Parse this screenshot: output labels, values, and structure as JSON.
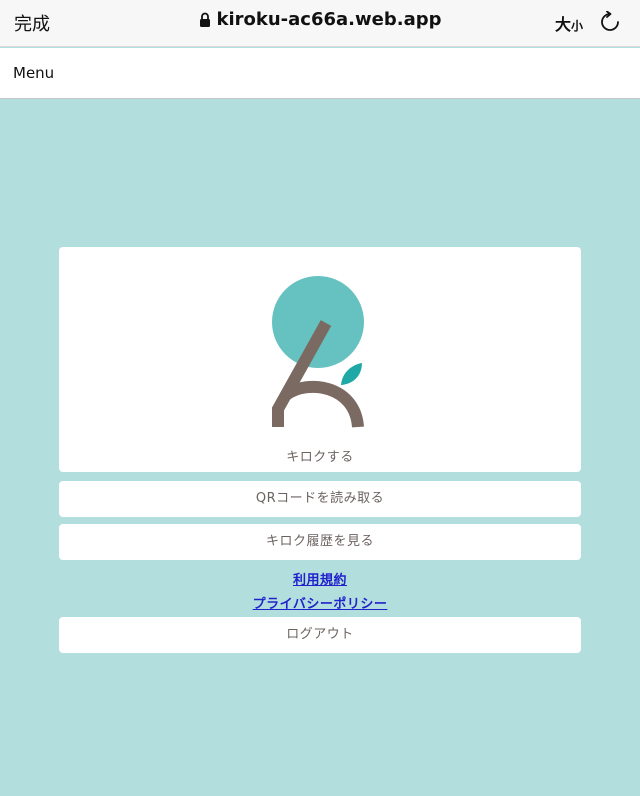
{
  "browser": {
    "done_label": "完成",
    "url": "kiroku-ac66a.web.app",
    "text_size_large": "大",
    "text_size_small": "小",
    "lock_icon": "lock-icon",
    "reload_icon": "reload-icon"
  },
  "menu": {
    "label": "Menu"
  },
  "main": {
    "logo_caption": "キロクする",
    "qr_button": "QRコードを読み取る",
    "history_button": "キロク履歴を見る",
    "terms_link": "利用規約",
    "privacy_link": "プライバシーポリシー",
    "logout_button": "ログアウト"
  },
  "colors": {
    "background": "#b2dfdd",
    "logo_circle": "#66c2c0",
    "logo_leaf": "#1fa8a6",
    "logo_stroke": "#7a6a62",
    "link": "#2222cc"
  }
}
